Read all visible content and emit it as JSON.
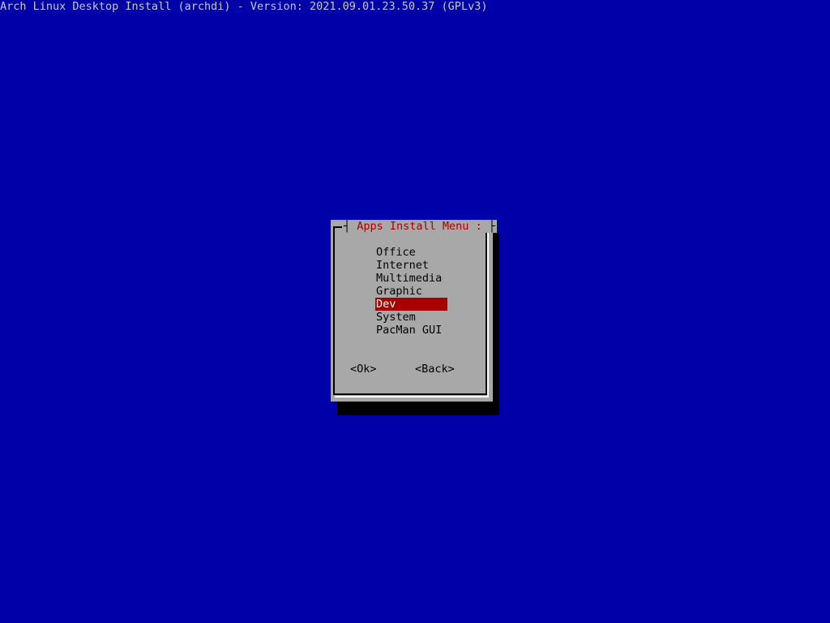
{
  "backtitle": "Arch Linux Desktop Install (archdi) - Version: 2021.09.01.23.50.37 (GPLv3)",
  "dialog": {
    "title": "Apps Install Menu :",
    "items": [
      {
        "label": "Office",
        "selected": false
      },
      {
        "label": "Internet",
        "selected": false
      },
      {
        "label": "Multimedia",
        "selected": false
      },
      {
        "label": "Graphic",
        "selected": false
      },
      {
        "label": "Dev",
        "selected": true
      },
      {
        "label": "System",
        "selected": false
      },
      {
        "label": "PacMan GUI",
        "selected": false
      }
    ],
    "buttons": {
      "ok": "<Ok>",
      "back": "<Back>"
    }
  },
  "colors": {
    "background": "#0000a8",
    "dialog": "#a8a8a8",
    "title": "#a80000",
    "selection": "#a80000",
    "shadow": "#000000"
  }
}
